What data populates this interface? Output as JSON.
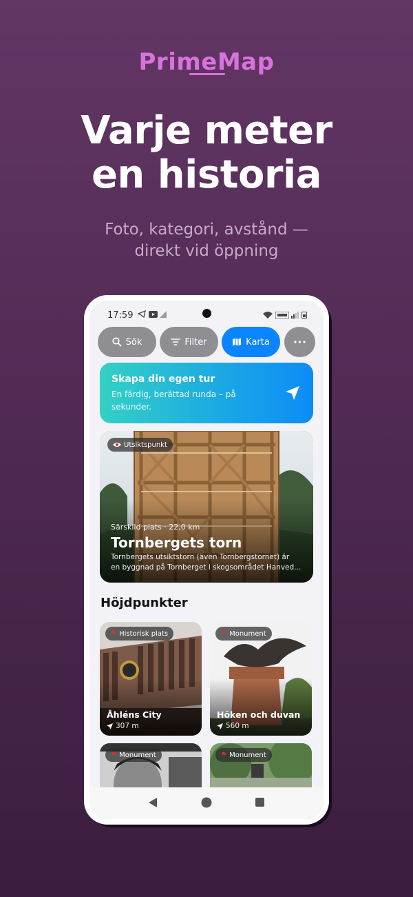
{
  "brand": "PrimeMap",
  "headline_line1": "Varje meter",
  "headline_line2": "en historia",
  "subline_line1": "Foto, kategori, avstånd —",
  "subline_line2": "direkt vid öppning",
  "status": {
    "time": "17:59"
  },
  "toolbar": {
    "search": "Sök",
    "filter": "Filter",
    "map": "Karta",
    "more": "•••"
  },
  "tour": {
    "title": "Skapa din egen tur",
    "text": "En färdig, berättad runda – på sekunder."
  },
  "featured": {
    "badge": "Utsiktspunkt",
    "meta": "Särskild plats · 22,0 km",
    "title": "Tornbergets torn",
    "desc1": "Tornbergets utsiktstorn (även Tornbergstornet) är",
    "desc2": "en byggnad på Tornberget i skogsområdet Hanved..."
  },
  "section_title": "Höjdpunkter",
  "highlights": [
    {
      "badge": "Historisk plats",
      "name": "Åhléns City",
      "distance": "307 m"
    },
    {
      "badge": "Monument",
      "name": "Höken och duvan",
      "distance": "560 m"
    },
    {
      "badge": "Monument",
      "name": "",
      "distance": ""
    },
    {
      "badge": "Monument",
      "name": "",
      "distance": ""
    }
  ],
  "colors": {
    "accent": "#0a84ff",
    "brand": "#d872dc",
    "background": "#4c2850"
  }
}
